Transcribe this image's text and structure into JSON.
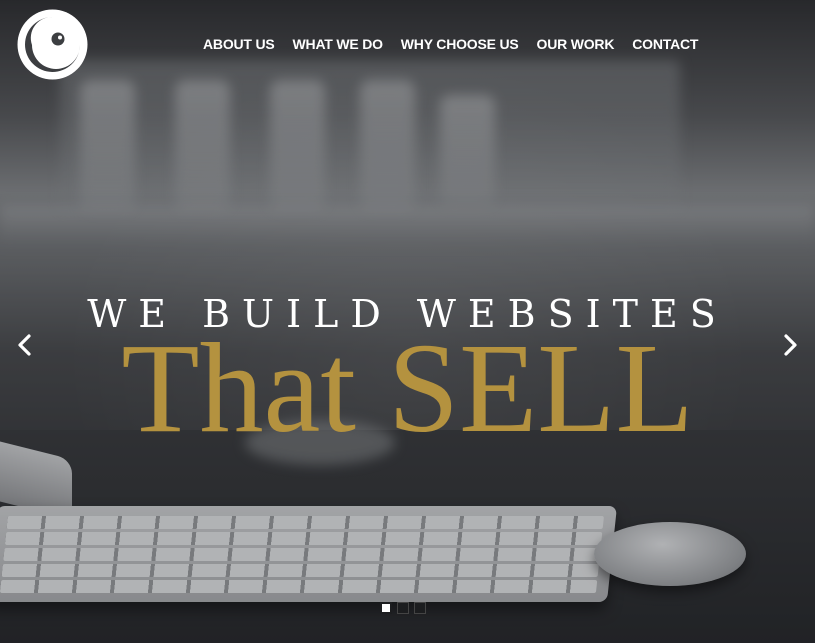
{
  "nav": {
    "items": [
      {
        "label": "ABOUT US"
      },
      {
        "label": "WHAT WE DO"
      },
      {
        "label": "WHY CHOOSE US"
      },
      {
        "label": "OUR WORK"
      },
      {
        "label": "CONTACT"
      }
    ]
  },
  "hero": {
    "tagline": "WE BUILD WEBSITES",
    "headline": "That SELL",
    "accent_color": "#b4923f"
  },
  "slider": {
    "prev_icon": "chevron-left-icon",
    "next_icon": "chevron-right-icon",
    "dots": [
      {
        "active": true
      },
      {
        "active": false
      },
      {
        "active": false
      }
    ]
  },
  "logo": {
    "icon": "swirl-logo-icon"
  }
}
